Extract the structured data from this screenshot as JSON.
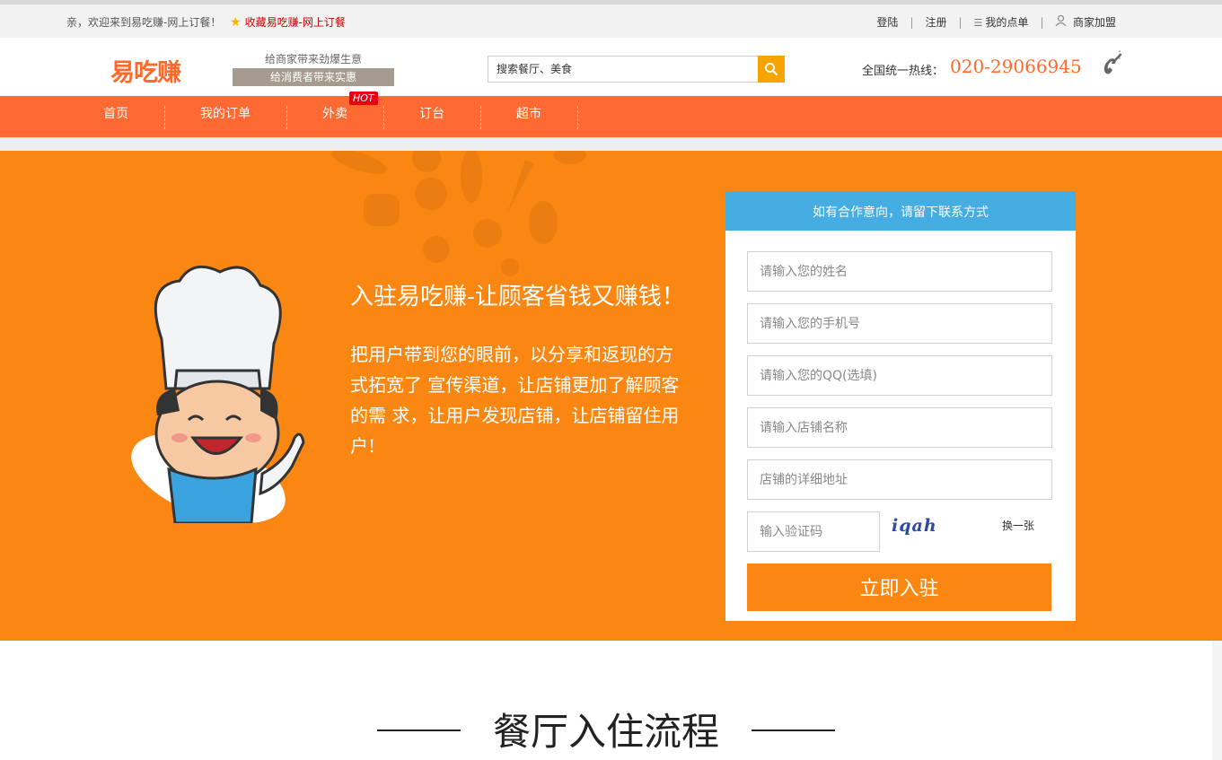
{
  "topbar": {
    "welcome": "亲，欢迎来到易吃赚-网上订餐！",
    "favorite": "收藏易吃赚-网上订餐",
    "login": "登陆",
    "register": "注册",
    "my_orders": "我的点单",
    "merchant_join": "商家加盟"
  },
  "header": {
    "logo": "易吃赚",
    "slogan_merchant": "给商家带来劲爆生意",
    "slogan_consumer": "给消费者带来实惠",
    "search_placeholder": "搜索餐厅、美食",
    "hotline_label": "全国统一热线：",
    "hotline_number": "020-29066945"
  },
  "nav": {
    "items": [
      "首页",
      "我的订单",
      "外卖",
      "订台",
      "超市"
    ],
    "hot_badge": "HOT"
  },
  "banner": {
    "title": "入驻易吃赚-让顾客省钱又赚钱！",
    "description": "把用户带到您的眼前，以分享和返现的方式拓宽了 宣传渠道，让店铺更加了解顾客的需 求，让用户发现店铺，让店铺留住用 户!"
  },
  "form": {
    "heading": "如有合作意向，请留下联系方式",
    "name_placeholder": "请输入您的姓名",
    "phone_placeholder": "请输入您的手机号",
    "qq_placeholder": "请输入您的QQ(选填)",
    "shop_name_placeholder": "请输入店铺名称",
    "address_placeholder": "店铺的详细地址",
    "captcha_placeholder": "输入验证码",
    "captcha_code": "iqah",
    "refresh": "换一张",
    "submit": "立即入驻"
  },
  "section": {
    "title": "餐厅入住流程"
  },
  "colors": {
    "nav": "#ff6a33",
    "banner": "#fb8713",
    "form_head": "#45ade1",
    "accent": "#ff6a2b"
  }
}
